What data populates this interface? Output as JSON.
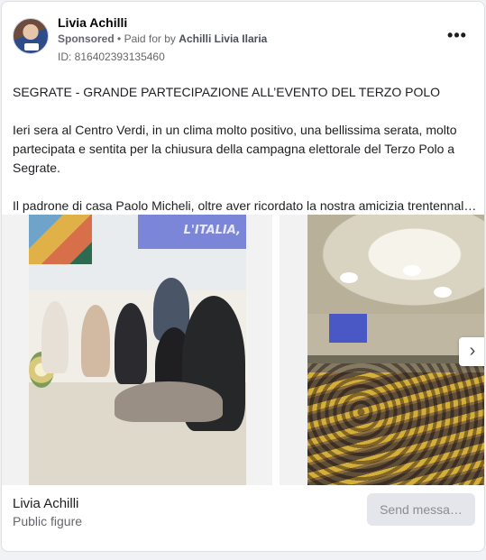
{
  "header": {
    "page_name": "Livia Achilli",
    "sponsored_label": "Sponsored",
    "separator": "•",
    "paid_for_prefix": "Paid for by",
    "paid_for_name": "Achilli Livia Ilaria",
    "ad_id": "ID: 816402393135460",
    "more_icon": "more-horizontal-icon",
    "more_glyph": "•••"
  },
  "post": {
    "paragraphs": [
      "SEGRATE - GRANDE PARTECIPAZIONE ALL’EVENTO DEL TERZO POLO",
      "Ieri sera al Centro Verdi, in un clima molto positivo, una bellissima serata, molto partecipata e sentita per la chiusura della campagna elettorale del Terzo Polo a Segrate.",
      "Il padrone di casa Paolo Micheli, oltre aver ricordato la nostra amicizia trentennal…"
    ]
  },
  "carousel": {
    "slide1_banner_text": "L'ITALIA,",
    "next_icon": "chevron-right-icon",
    "next_glyph": "›"
  },
  "footer": {
    "name": "Livia Achilli",
    "category": "Public figure",
    "button_label": "Send messa…"
  },
  "colors": {
    "card_bg": "#ffffff",
    "page_bg": "#f0f2f5",
    "muted_text": "#65676b",
    "button_bg": "#e4e6eb",
    "button_text": "#8a8d91",
    "banner": "#7b86d9"
  }
}
